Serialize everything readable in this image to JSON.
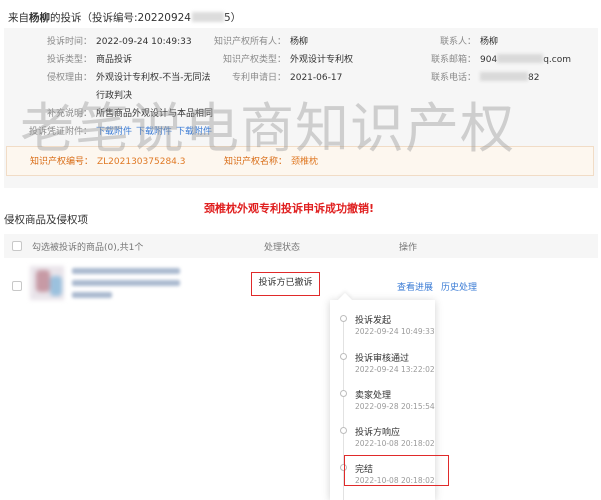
{
  "header": {
    "prefix": "来自",
    "name": "杨柳",
    "suffix": "的投诉（投诉编号:20220924",
    "tail": "5）"
  },
  "complaint": {
    "time_label": "投诉时间：",
    "time_value": "2022-09-24 10:49:33",
    "owner_label": "知识产权所有人：",
    "owner_value": "杨柳",
    "contact_label": "联系人：",
    "contact_value": "杨柳",
    "type_label": "投诉类型：",
    "type_value": "商品投诉",
    "ip_type_label": "知识产权类型：",
    "ip_type_value": "外观设计专利权",
    "email_label": "联系邮箱：",
    "email_prefix": "904",
    "email_suffix": "q.com",
    "reason_label": "侵权理由：",
    "reason_value": "外观设计专利权-不当-无同法",
    "apply_date_label": "专利申请日：",
    "apply_date_value": "2021-06-17",
    "phone_label": "联系电话：",
    "phone_suffix": "82",
    "reason_extra": "行政判决",
    "note_label": "补充说明：",
    "note_value": "所售商品外观设计与本品相同",
    "attach_label": "投诉凭证附件：",
    "attachments": [
      "下载附件",
      "下载附件",
      "下载附件"
    ],
    "ip_no_label": "知识产权编号：",
    "ip_no_value": "ZL202130375284.3",
    "ip_name_label": "知识产权名称：",
    "ip_name_value": "颈椎枕"
  },
  "watermark": "老笔说电商知识产权",
  "banner": "颈椎枕外观专利投诉申诉成功撤销!",
  "section_title": "侵权商品及侵权项",
  "table": {
    "col_goods": "勾选被投诉的商品(0),共1个",
    "col_status": "处理状态",
    "col_action": "操作"
  },
  "row": {
    "status": "投诉方已撤诉",
    "action_view": "查看进展",
    "action_history": "历史处理"
  },
  "timeline": [
    {
      "title": "投诉发起",
      "time": "2022-09-24 10:49:33"
    },
    {
      "title": "投诉审核通过",
      "time": "2022-09-24 13:22:02"
    },
    {
      "title": "卖家处理",
      "time": "2022-09-28 20:15:54"
    },
    {
      "title": "投诉方响应",
      "time": "2022-10-08 20:18:02"
    },
    {
      "title": "完结",
      "time": "2022-10-08 20:18:02"
    }
  ],
  "colors": {
    "link": "#3a7bd5",
    "alert": "#e02020",
    "ip_label": "#d86b14"
  }
}
